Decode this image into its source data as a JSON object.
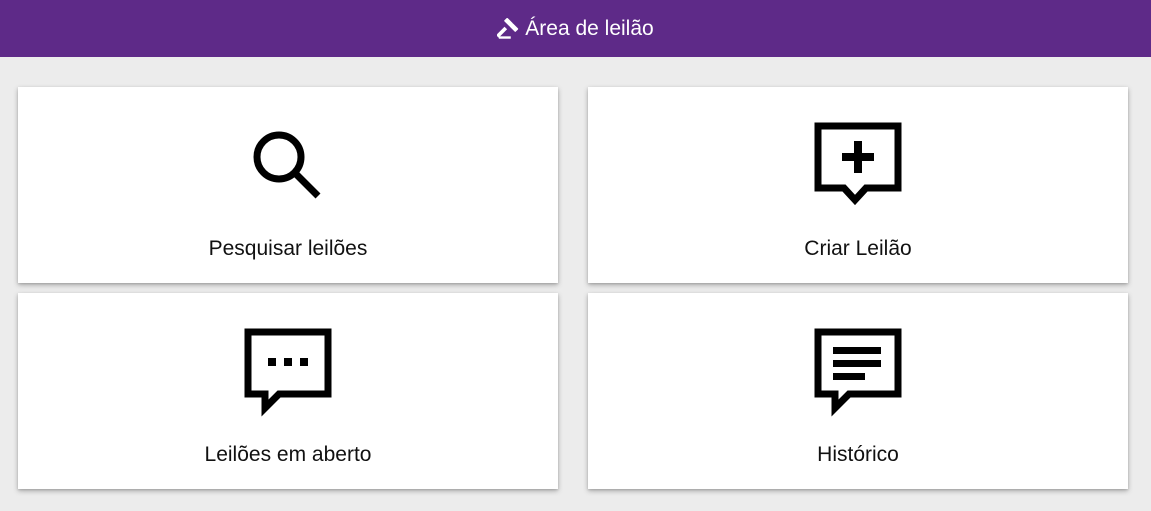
{
  "header": {
    "title": "Área de leilão",
    "icon": "gavel-icon",
    "background_color": "#5e2a88"
  },
  "cards": [
    {
      "label": "Pesquisar leilões",
      "icon": "search-icon"
    },
    {
      "label": "Criar Leilão",
      "icon": "add-comment-icon"
    },
    {
      "label": "Leilões em aberto",
      "icon": "comment-dots-icon"
    },
    {
      "label": "Histórico",
      "icon": "comment-text-icon"
    }
  ]
}
